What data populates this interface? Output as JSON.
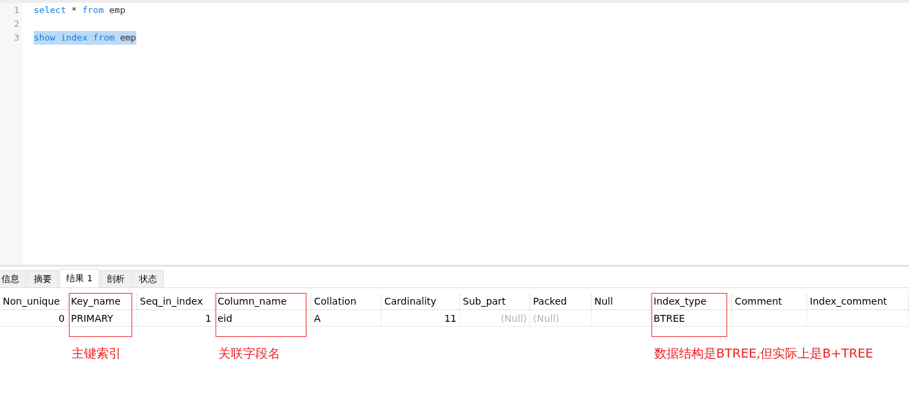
{
  "editor": {
    "lines": [
      {
        "number": "1",
        "selected": false,
        "tokens": [
          {
            "text": "select",
            "kind": "keyword"
          },
          {
            "text": "*",
            "kind": "plain"
          },
          {
            "text": "from",
            "kind": "keyword"
          },
          {
            "text": "emp",
            "kind": "plain"
          }
        ]
      },
      {
        "number": "2"
      },
      {
        "number": "3",
        "selected": true,
        "tokens": [
          {
            "text": "show",
            "kind": "keyword"
          },
          {
            "text": "index",
            "kind": "keyword"
          },
          {
            "text": "from",
            "kind": "keyword"
          },
          {
            "text": "emp",
            "kind": "plain"
          }
        ]
      }
    ]
  },
  "tabs": [
    {
      "label": "信息",
      "selected": false
    },
    {
      "label": "摘要",
      "selected": false
    },
    {
      "label": "结果 1",
      "selected": true
    },
    {
      "label": "剖析",
      "selected": false
    },
    {
      "label": "状态",
      "selected": false
    }
  ],
  "table": {
    "columns": [
      {
        "name": "Non_unique",
        "value": "0",
        "kind": "number",
        "null": false
      },
      {
        "name": "Key_name",
        "value": "PRIMARY",
        "kind": "text",
        "null": false,
        "note": "主键索引"
      },
      {
        "name": "Seq_in_index",
        "value": "1",
        "kind": "number",
        "null": false
      },
      {
        "name": "Column_name",
        "value": "eid",
        "kind": "text",
        "null": false,
        "note": "关联字段名"
      },
      {
        "name": "Collation",
        "value": "A",
        "kind": "text",
        "null": false
      },
      {
        "name": "Cardinality",
        "value": "11",
        "kind": "number",
        "null": false
      },
      {
        "name": "Sub_part",
        "value": "(Null)",
        "kind": "number",
        "null": true
      },
      {
        "name": "Packed",
        "value": "(Null)",
        "kind": "text",
        "null": true
      },
      {
        "name": "Null",
        "kind": "text"
      },
      {
        "name": "Index_type",
        "value": "BTREE",
        "kind": "text",
        "null": false,
        "note": "数据结构是BTREE,但实际上是B+TREE"
      },
      {
        "name": "Comment",
        "kind": "text"
      },
      {
        "name": "Index_comment",
        "kind": "text"
      }
    ]
  }
}
